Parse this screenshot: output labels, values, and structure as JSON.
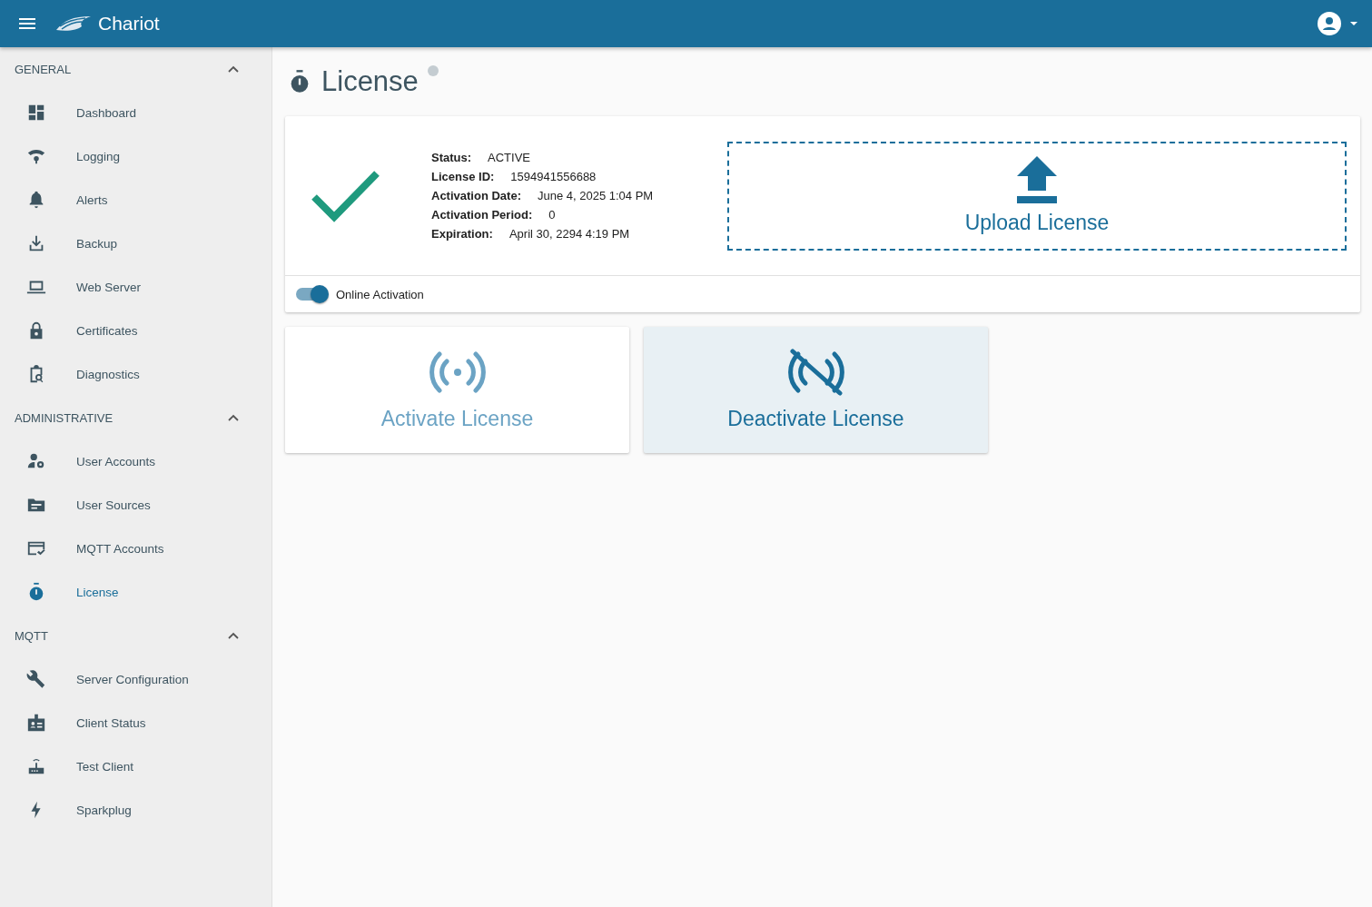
{
  "header": {
    "app_name": "Chariot"
  },
  "sidebar": {
    "sections": [
      {
        "title": "GENERAL",
        "expanded": true,
        "items": [
          {
            "label": "Dashboard",
            "selected": false
          },
          {
            "label": "Logging",
            "selected": false
          },
          {
            "label": "Alerts",
            "selected": false
          },
          {
            "label": "Backup",
            "selected": false
          },
          {
            "label": "Web Server",
            "selected": false
          },
          {
            "label": "Certificates",
            "selected": false
          },
          {
            "label": "Diagnostics",
            "selected": false
          }
        ]
      },
      {
        "title": "ADMINISTRATIVE",
        "expanded": true,
        "items": [
          {
            "label": "User Accounts",
            "selected": false
          },
          {
            "label": "User Sources",
            "selected": false
          },
          {
            "label": "MQTT Accounts",
            "selected": false
          },
          {
            "label": "License",
            "selected": true
          }
        ]
      },
      {
        "title": "MQTT",
        "expanded": true,
        "items": [
          {
            "label": "Server Configuration",
            "selected": false
          },
          {
            "label": "Client Status",
            "selected": false
          },
          {
            "label": "Test Client",
            "selected": false
          },
          {
            "label": "Sparkplug",
            "selected": false
          }
        ]
      }
    ]
  },
  "page": {
    "title": "License"
  },
  "license": {
    "active": true,
    "fields": [
      {
        "label": "Status:",
        "value": "ACTIVE"
      },
      {
        "label": "License ID:",
        "value": "1594941556688"
      },
      {
        "label": "Activation Date:",
        "value": "June 4, 2025 1:04 PM"
      },
      {
        "label": "Activation Period:",
        "value": "0"
      },
      {
        "label": "Expiration:",
        "value": "April 30, 2294 4:19 PM"
      }
    ],
    "upload_label": "Upload License",
    "online_activation": {
      "label": "Online Activation",
      "on": true
    }
  },
  "actions": [
    {
      "kind": "activate",
      "label": "Activate License",
      "disabled": true
    },
    {
      "kind": "deactivate",
      "label": "Deactivate License",
      "disabled": false
    }
  ]
}
